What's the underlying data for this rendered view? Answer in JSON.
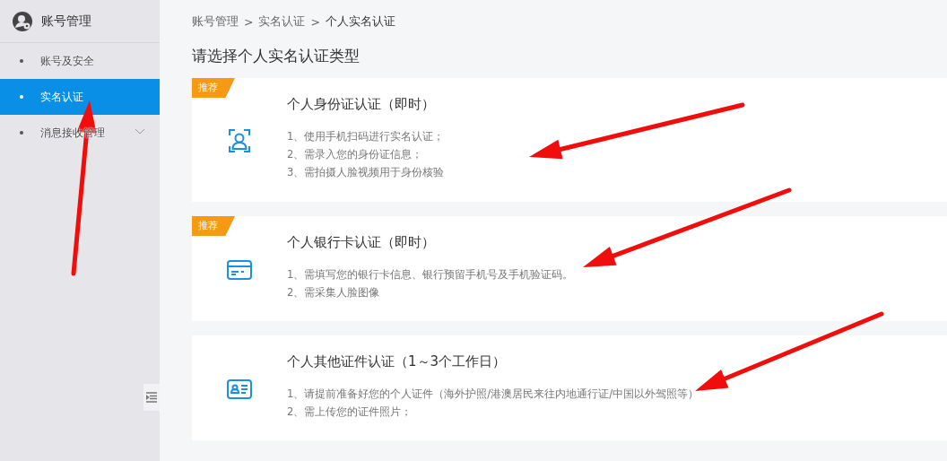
{
  "sidebar": {
    "title": "账号管理",
    "items": [
      {
        "label": "账号及安全",
        "selected": false,
        "expandable": false
      },
      {
        "label": "实名认证",
        "selected": true,
        "expandable": false
      },
      {
        "label": "消息接收管理",
        "selected": false,
        "expandable": true
      }
    ]
  },
  "breadcrumb": [
    "账号管理",
    "实名认证",
    "个人实名认证"
  ],
  "breadcrumb_separator": ">",
  "heading": "请选择个人实名认证类型",
  "options": [
    {
      "kind": "face-scan",
      "badge": "推荐",
      "title": "个人身份证认证（即时）",
      "lines": [
        "1、使用手机扫码进行实名认证；",
        "2、需录入您的身份证信息；",
        "3、需拍摄人脸视频用于身份核验"
      ]
    },
    {
      "kind": "bank-card",
      "badge": "推荐",
      "title": "个人银行卡认证（即时）",
      "lines": [
        "1、需填写您的银行卡信息、银行预留手机号及手机验证码。",
        "2、需采集人脸图像"
      ]
    },
    {
      "kind": "id-card",
      "title": "个人其他证件认证（1～3个工作日）",
      "lines": [
        "1、请提前准备好您的个人证件（海外护照/港澳居民来往内地通行证/中国以外驾照等）",
        "2、需上传您的证件照片；"
      ]
    }
  ]
}
